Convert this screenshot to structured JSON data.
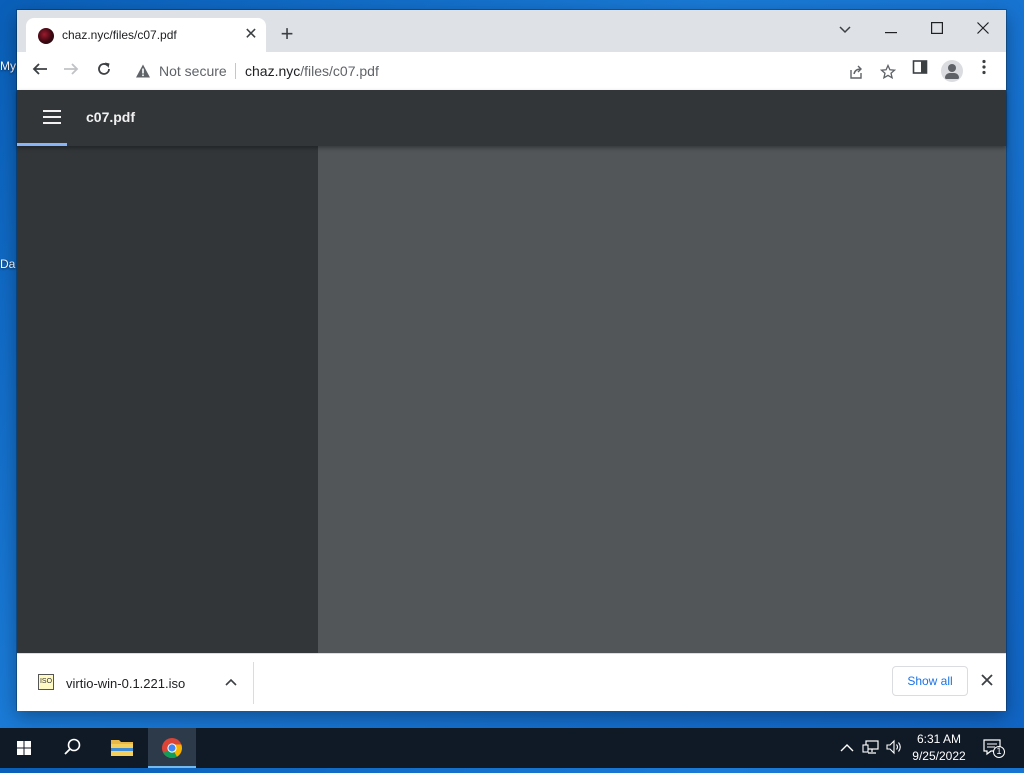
{
  "desktop": {
    "fragment_1": "My",
    "fragment_2": "Da"
  },
  "browser": {
    "tab": {
      "title": "chaz.nyc/files/c07.pdf"
    },
    "window_controls": {
      "tab_search": "chevron-down-icon",
      "minimize": "minimize-icon",
      "maximize": "maximize-icon",
      "close": "close-icon"
    },
    "address_bar": {
      "security_label": "Not secure",
      "url_host": "chaz.nyc",
      "url_path": "/files/c07.pdf"
    },
    "toolbar_icons": [
      "share-icon",
      "star-icon",
      "side-panel-icon",
      "profile-icon",
      "kebab-menu-icon"
    ]
  },
  "pdf_viewer": {
    "title": "c07.pdf"
  },
  "download_shelf": {
    "file_name": "virtio-win-0.1.221.iso",
    "file_icon_label": "ISO",
    "show_all_label": "Show all"
  },
  "taskbar": {
    "clock_time": "6:31 AM",
    "clock_date": "9/25/2022",
    "notification_count": "1"
  },
  "colors": {
    "viewer_header": "#323639",
    "viewer_background": "#525659",
    "accent": "#8ab4f8",
    "link_blue": "#1a73e8"
  }
}
